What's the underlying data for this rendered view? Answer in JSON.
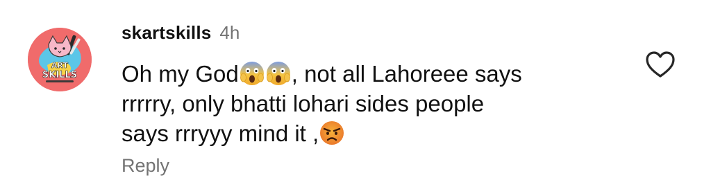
{
  "comment": {
    "avatar": {
      "logo_text_top": "ART",
      "logo_text_bottom": "SKILLS",
      "background_color": "#f06b6b"
    },
    "username": "skartskills",
    "timestamp": "4h",
    "text": {
      "line1_a": "Oh my God",
      "line1_b": ", not all Lahoreee says",
      "line2": "rrrrry, only bhatti lohari sides people",
      "line3": "says rrryyy mind it ,"
    },
    "emojis": [
      "face-screaming-in-fear-emoji",
      "face-screaming-in-fear-emoji",
      "angry-face-emoji"
    ],
    "reply_label": "Reply",
    "like_icon": "heart-outline-icon"
  }
}
